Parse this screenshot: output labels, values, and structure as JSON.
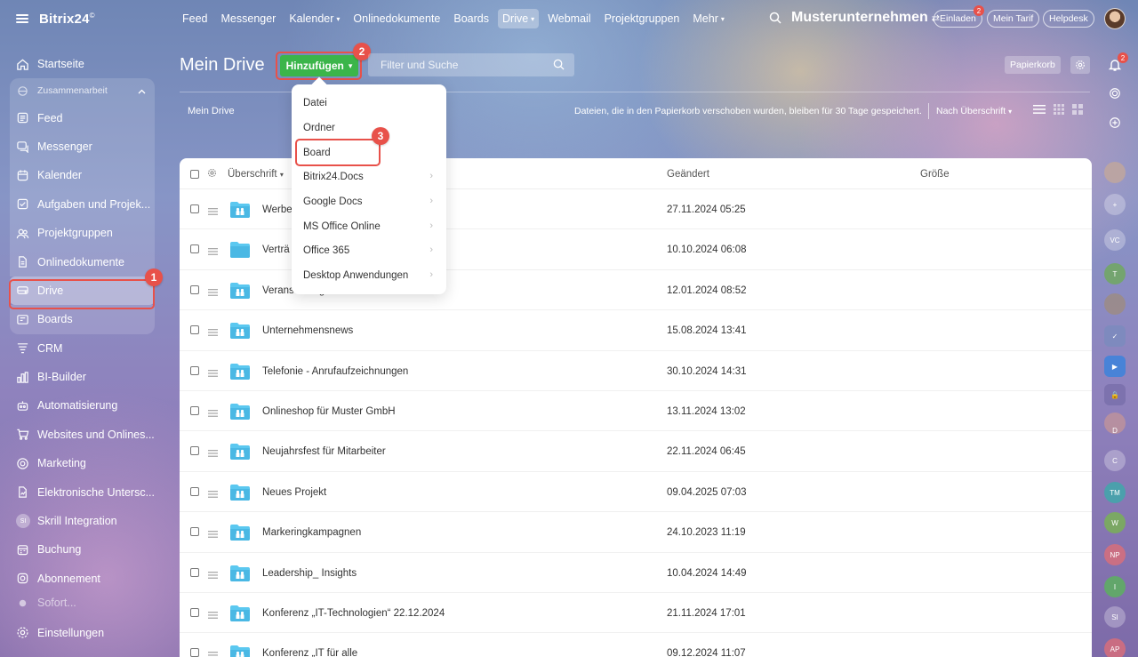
{
  "app": {
    "logo": "Bitrix24",
    "logo_mark": "©"
  },
  "sidebar": {
    "items": [
      {
        "label": "Startseite",
        "icon": "home-icon"
      },
      {
        "label": "Zusammenarbeit",
        "icon": "collab-icon"
      },
      {
        "label": "Feed",
        "icon": "feed-icon"
      },
      {
        "label": "Messenger",
        "icon": "chat-icon"
      },
      {
        "label": "Kalender",
        "icon": "calendar-icon"
      },
      {
        "label": "Aufgaben und Projek...",
        "icon": "tasks-icon"
      },
      {
        "label": "Projektgruppen",
        "icon": "groups-icon"
      },
      {
        "label": "Onlinedokumente",
        "icon": "docs-icon"
      },
      {
        "label": "Drive",
        "icon": "drive-icon"
      },
      {
        "label": "Boards",
        "icon": "boards-icon"
      },
      {
        "label": "CRM",
        "icon": "crm-icon"
      },
      {
        "label": "BI-Builder",
        "icon": "bi-icon"
      },
      {
        "label": "Automatisierung",
        "icon": "robot-icon"
      },
      {
        "label": "Websites und Onlines...",
        "icon": "cart-icon"
      },
      {
        "label": "Marketing",
        "icon": "marketing-icon"
      },
      {
        "label": "Elektronische Untersc...",
        "icon": "sign-icon"
      },
      {
        "label": "Skrill Integration",
        "icon": "si-avatar"
      },
      {
        "label": "Buchung",
        "icon": "booking-icon"
      },
      {
        "label": "Abonnement",
        "icon": "subscription-icon"
      },
      {
        "label": "Sofort...",
        "icon": "app-icon"
      }
    ],
    "settings_label": "Einstellungen",
    "si_initials": "SI"
  },
  "topnav": {
    "tabs": [
      "Feed",
      "Messenger",
      "Kalender",
      "Onlinedokumente",
      "Boards",
      "Drive",
      "Webmail",
      "Projektgruppen",
      "Mehr"
    ],
    "company": "Musterunternehmen",
    "company_switch": "⇄",
    "invite_label": "Einladen",
    "invite_badge": "2",
    "tariff_label": "Mein Tarif",
    "helpdesk_label": "Helpdesk"
  },
  "page": {
    "title": "Mein Drive",
    "add_label": "Hinzufügen",
    "filter_placeholder": "Filter und Suche",
    "trash_label": "Papierkorb",
    "breadcrumb": "Mein Drive",
    "trash_note": "Dateien, die in den Papierkorb verschoben wurden, bleiben für 30 Tage gespeichert.",
    "sort_label": "Nach Überschrift"
  },
  "table": {
    "headers": {
      "name": "Überschrift",
      "changed": "Geändert",
      "size": "Größe"
    },
    "rows": [
      {
        "name": "Werbe",
        "date": "27.11.2024 05:25",
        "shared": true
      },
      {
        "name": "Verträ",
        "date": "10.10.2024 06:08",
        "shared": false
      },
      {
        "name": "Veranstaltung",
        "date": "12.01.2024 08:52",
        "shared": true
      },
      {
        "name": "Unternehmensnews",
        "date": "15.08.2024 13:41",
        "shared": true
      },
      {
        "name": "Telefonie - Anrufaufzeichnungen",
        "date": "30.10.2024 14:31",
        "shared": true
      },
      {
        "name": "Onlineshop für Muster GmbH",
        "date": "13.11.2024 13:02",
        "shared": true
      },
      {
        "name": "Neujahrsfest für Mitarbeiter",
        "date": "22.11.2024 06:45",
        "shared": true
      },
      {
        "name": "Neues Projekt",
        "date": "09.04.2025 07:03",
        "shared": true
      },
      {
        "name": "Markeringkampagnen",
        "date": "24.10.2023 11:19",
        "shared": true
      },
      {
        "name": "Leadership_ Insights",
        "date": "10.04.2024 14:49",
        "shared": true
      },
      {
        "name": "Konferenz „IT-Technologien“ 22.12.2024",
        "date": "21.11.2024 17:01",
        "shared": true
      },
      {
        "name": "Konferenz „IT für alle",
        "date": "09.12.2024 11:07",
        "shared": true
      }
    ]
  },
  "dropdown": {
    "items": [
      {
        "label": "Datei",
        "submenu": false
      },
      {
        "label": "Ordner",
        "submenu": false
      },
      {
        "label": "Board",
        "submenu": false
      },
      {
        "label": "Bitrix24.Docs",
        "submenu": true
      },
      {
        "label": "Google Docs",
        "submenu": true
      },
      {
        "label": "MS Office Online",
        "submenu": true
      },
      {
        "label": "Office 365",
        "submenu": true
      },
      {
        "label": "Desktop Anwendungen",
        "submenu": true
      }
    ]
  },
  "annotations": {
    "step1": "1",
    "step2": "2",
    "step3": "3"
  },
  "rail": {
    "notify_badge": "2",
    "initials": [
      "VC",
      "T",
      "D",
      "C",
      "TM",
      "W",
      "NP",
      "I",
      "SI",
      "AP"
    ]
  },
  "colors": {
    "accent_green": "#3bb54a",
    "highlight_red": "#e8514a",
    "folder_blue": "#5bc8f0"
  }
}
